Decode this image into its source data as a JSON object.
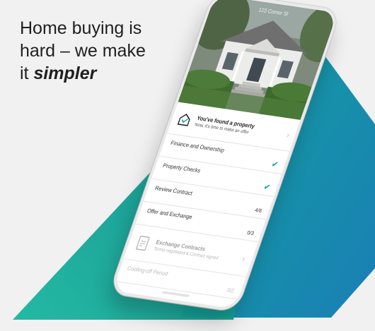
{
  "headline": {
    "line1": "Home buying is",
    "line2": "hard – we make",
    "line3_prefix": "it ",
    "line3_emphasis": "simpler"
  },
  "colors": {
    "background": "#f1f1f1",
    "teal_dark": "#0d8d8a",
    "teal_light": "#1fb89e",
    "blue": "#1a7fb6",
    "check": "#1fa3b5"
  },
  "phone": {
    "address": "123 Corner St",
    "found_property": {
      "title": "You've found a property",
      "subtitle": "Now, it's time to make an offer",
      "icon": "house-icon"
    },
    "steps": [
      {
        "label": "Finance and Ownership",
        "status": "check"
      },
      {
        "label": "Property Checks",
        "status": "check"
      },
      {
        "label": "Review Contract",
        "count": "4/6"
      },
      {
        "label": "Offer and Exchange",
        "count": "0/3"
      }
    ],
    "exchange_contracts": {
      "title": "Exchange Contracts",
      "subtitle": "Terms negotiated & Contract signed",
      "icon": "document-icon"
    },
    "cooling_off": {
      "label": "Cooling-off Period",
      "count": "0/2"
    }
  }
}
